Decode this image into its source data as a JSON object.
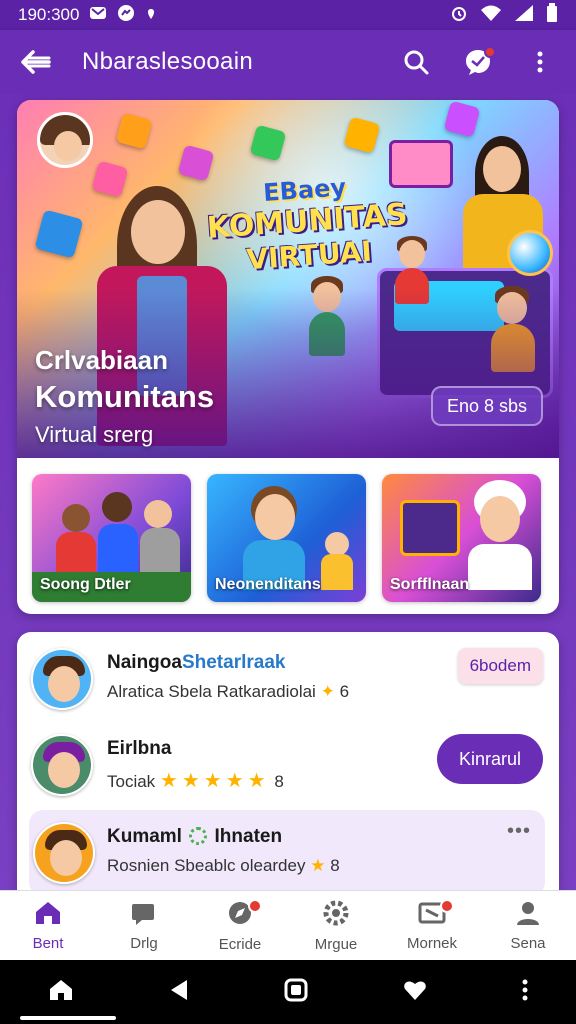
{
  "status_bar": {
    "time": "190:300",
    "icons": [
      "mail-icon",
      "messenger-icon",
      "dot-icon"
    ],
    "right_icons": [
      "alarm-icon",
      "wifi-icon",
      "signal-icon",
      "battery-icon"
    ]
  },
  "app_bar": {
    "title": "Nbaraslesooain",
    "back_icon": "arrow-left-icon",
    "search_icon": "search-icon",
    "chat_icon": "chat-bubble-icon",
    "more_icon": "more-vert-icon"
  },
  "hero": {
    "logo_line1": "EBaey",
    "logo_line2": "KOMUNITAS",
    "logo_line3": "VIRTUAI",
    "title_line1": "Crlvabiaan",
    "title_line2": "Komunitans",
    "title_line3": "Virtual srerg",
    "chip": "Eno 8 sbs"
  },
  "thumbnails": [
    {
      "label": "Soong Dtler"
    },
    {
      "label": "Neonenditans"
    },
    {
      "label": "Sorfflnaan"
    }
  ],
  "list": [
    {
      "name": "Naingoa",
      "name_highlight": "Shetarlraak",
      "subtitle": "Alratica Sbela Ratkaradiolai",
      "sub_suffix": "6",
      "action": "6bodem"
    },
    {
      "name": "Eirlbna",
      "subtitle": "Tociak",
      "rating": "★★★★★",
      "sub_suffix": "8",
      "action": "Kinrarul"
    },
    {
      "name": "Kumaml",
      "name_suffix": "Ihnaten",
      "subtitle": "Rosnien Sbeablc oleardey",
      "sub_suffix": "8",
      "more": "•••"
    }
  ],
  "bottom_nav": [
    {
      "label": "Bent",
      "icon": "home-icon",
      "active": true
    },
    {
      "label": "Drlg",
      "icon": "chat-icon",
      "active": false
    },
    {
      "label": "Ecride",
      "icon": "compass-icon",
      "active": false,
      "badge": true
    },
    {
      "label": "Mrgue",
      "icon": "settings-icon",
      "active": false
    },
    {
      "label": "Mornek",
      "icon": "inbox-icon",
      "active": false,
      "badge": true
    },
    {
      "label": "Sena",
      "icon": "person-icon",
      "active": false
    }
  ],
  "colors": {
    "primary": "#6a2db5",
    "accent": "#ffb300",
    "badge": "#e53935"
  }
}
